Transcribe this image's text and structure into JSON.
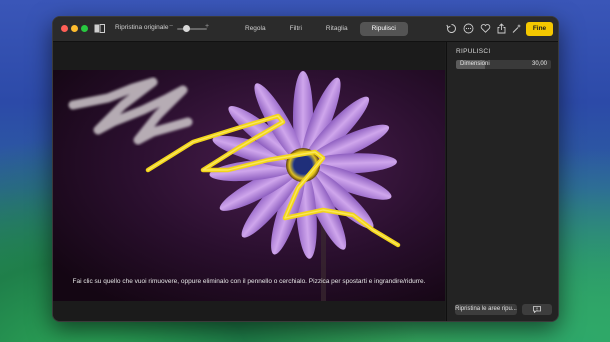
{
  "toolbar": {
    "revert_label": "Ripristina originale",
    "zoom_minus": "−",
    "zoom_plus": "+",
    "tabs": [
      {
        "label": "Regola"
      },
      {
        "label": "Filtri"
      },
      {
        "label": "Ritaglia"
      },
      {
        "label": "Ripulisci"
      }
    ],
    "active_tab": "Ripulisci",
    "done_label": "Fine",
    "icons": [
      "compare-icon",
      "rotate-icon",
      "more-icon",
      "favorite-heart-icon",
      "share-icon",
      "magic-wand-icon"
    ]
  },
  "canvas": {
    "hint": "Fai clic su quello che vuoi rimuovere, oppure eliminalo con il pennello o cerchialo. Pizzica per spostarti e ingrandire/ridurre."
  },
  "sidebar": {
    "title": "RIPULISCI",
    "size_label": "Dimensioni",
    "size_value": "30,00",
    "size_fraction": 0.3,
    "reset_label": "Ripristina le aree ripu...",
    "feedback_icon": "feedback-icon"
  },
  "colors": {
    "accent": "#f5c800",
    "stroke": "#f2d51a",
    "petal": "#b98ad9"
  }
}
